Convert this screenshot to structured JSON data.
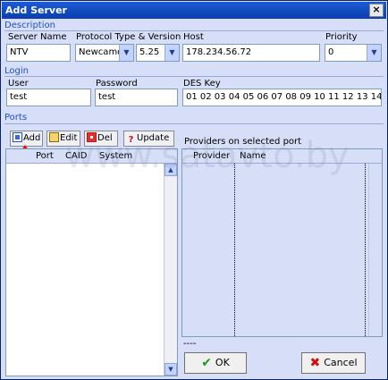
{
  "window": {
    "title": "Add Server",
    "close_glyph": "×"
  },
  "description": {
    "section_label": "Description",
    "server_name_label": "Server Name",
    "server_name_value": "NTV",
    "protocol_label": "Protocol Type & Version",
    "protocol_value": "Newcamd",
    "version_value": "5.25",
    "host_label": "Host",
    "host_value": "178.234.56.72",
    "priority_label": "Priority",
    "priority_value": "0"
  },
  "login": {
    "section_label": "Login",
    "user_label": "User",
    "user_value": "test",
    "password_label": "Password",
    "password_value": "test",
    "des_key_label": "DES Key",
    "des_key_value": "01 02 03 04 05 06 07 08 09 10 11 12 13 14"
  },
  "ports": {
    "section_label": "Ports",
    "toolbar": {
      "add_label": "Add",
      "edit_label": "Edit",
      "del_label": "Del",
      "update_label": "Update"
    },
    "columns": [
      "Port",
      "CAID",
      "System"
    ]
  },
  "providers": {
    "title": "Providers on selected port",
    "columns": [
      "Provider",
      "Name"
    ],
    "status_text": "----"
  },
  "buttons": {
    "ok_label": "OK",
    "cancel_label": "Cancel"
  },
  "watermark": "www.satavto.by",
  "colors": {
    "accent": "#1e50c8",
    "titlebar": "#0b3eb0",
    "background": "#d6dff7"
  }
}
